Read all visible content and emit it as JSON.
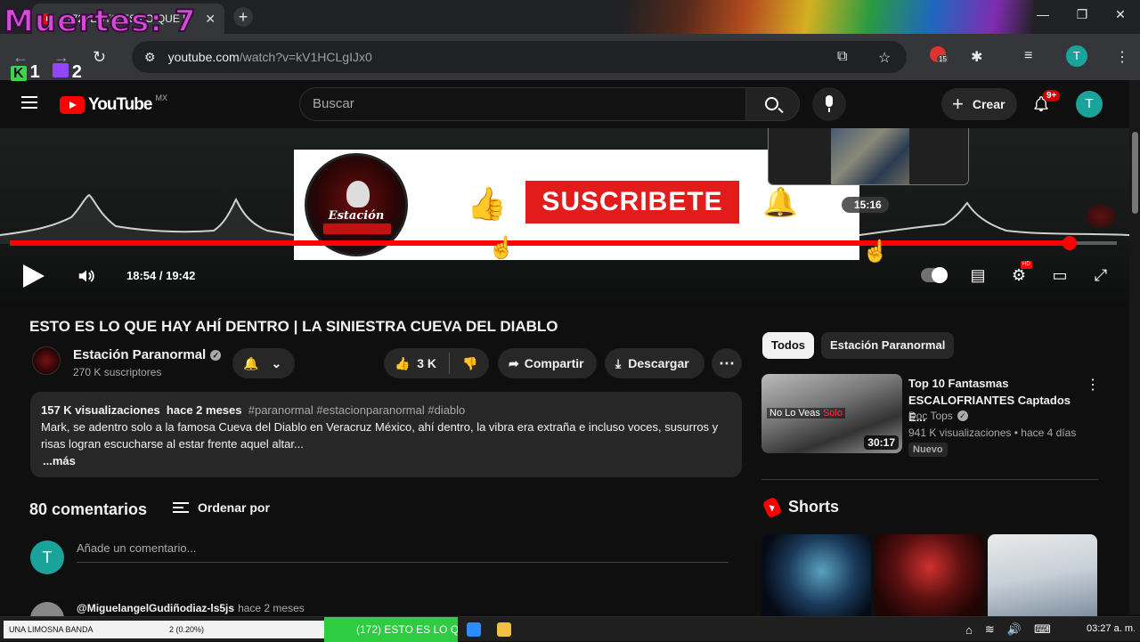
{
  "browser": {
    "tab_title": "(172) ESTO ES LO QUE H",
    "tab_close": "✕",
    "new_tab": "+",
    "url_host": "youtube.com",
    "url_path": "/watch?v=kV1HCLgIJx0",
    "ext_badge_count": "15",
    "profile_initial": "T",
    "window_controls": [
      "—",
      "❐",
      "✕"
    ]
  },
  "stream_overlay": {
    "deaths_label": "Muertes: 7",
    "kick_count": "1",
    "twitch_count": "2",
    "kick_icon_text": "K"
  },
  "masthead": {
    "logo_text": "YouTube",
    "country_code": "MX",
    "search_placeholder": "Buscar",
    "create_label": "Crear",
    "notifications_badge": "9+",
    "avatar_initial": "T"
  },
  "player": {
    "card_channel_top": "Estación",
    "subscribe_label": "SUSCRIBETE",
    "preview_time": "15:16",
    "current_time": "18:54",
    "duration": "19:42",
    "timecode": "18:54 / 19:42",
    "progress_fraction": 0.957,
    "hover_fraction": 0.776
  },
  "video": {
    "title": "ESTO ES LO QUE HAY AHÍ DENTRO | LA SINIESTRA CUEVA DEL DIABLO",
    "channel_name": "Estación Paranormal",
    "subscribers": "270 K suscriptores",
    "likes": "3 K",
    "share_label": "Compartir",
    "download_label": "Descargar",
    "more_label": "⋯",
    "views": "157 K visualizaciones",
    "published": "hace 2 meses",
    "hashtags": "#paranormal #estacionparanormal #diablo",
    "description": "Mark, se adentro solo a la famosa Cueva del Diablo en Veracruz México, ahí dentro, la vibra era extraña e incluso voces, susurros y risas logran escucharse al estar frente aquel altar...",
    "more_link": "...más"
  },
  "comments": {
    "count_label": "80 comentarios",
    "sort_label": "Ordenar por",
    "input_placeholder": "Añade un comentario...",
    "my_initial": "T",
    "first_author": "@MiguelangelGudiñodiaz-ls5js",
    "first_time": "hace 2 meses"
  },
  "sidebar": {
    "chips": [
      "Todos",
      "Estación Paranormal"
    ],
    "recommended": {
      "title": "Top 10 Fantasmas ESCALOFRIANTES Captados E...",
      "channel": "Doc Tops",
      "stats": "941 K visualizaciones • hace 4 días",
      "badge": "Nuevo",
      "duration": "30:17",
      "thumb_label_a": "No Lo Veas",
      "thumb_label_b": "Solo"
    },
    "shorts_title": "Shorts"
  },
  "taskbar": {
    "media_song": "UNA LIMOSNA BANDA",
    "media_count": "2 (0.20%)",
    "active_task": "(172) ESTO ES LO QUE...",
    "clock": "03:27 a. m."
  },
  "colors": {
    "yt_red": "#ff0000",
    "subscribe_red": "#e21b1b",
    "teal_avatar": "#1aa39a",
    "taskbar_active": "#2ecc40"
  }
}
